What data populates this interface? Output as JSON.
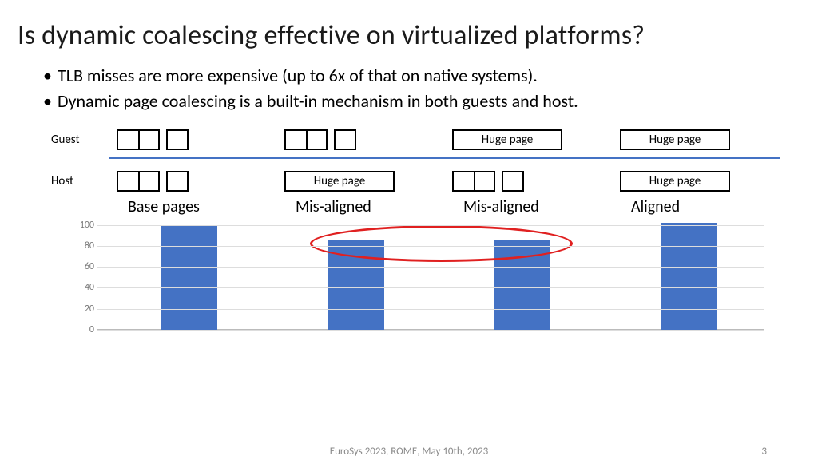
{
  "title": "Is dynamic coalescing effective on virtualized platforms?",
  "bullets": [
    "TLB misses are more expensive (up to 6x of that on native systems).",
    "Dynamic page coalescing is a built-in mechanism in both guests and host."
  ],
  "row_labels": {
    "guest": "Guest",
    "host": "Host"
  },
  "hugepage_label": "Huge page",
  "categories": [
    "Base pages",
    "Mis-aligned",
    "Mis-aligned",
    "Aligned"
  ],
  "chart_data": {
    "type": "bar",
    "categories": [
      "Base pages",
      "Mis-aligned",
      "Mis-aligned",
      "Aligned"
    ],
    "values": [
      100,
      86,
      86,
      102
    ],
    "ylim": [
      0,
      104
    ],
    "yticks": [
      0,
      20,
      40,
      60,
      80,
      100
    ],
    "title": "",
    "xlabel": "",
    "ylabel": ""
  },
  "footer": {
    "venue": "EuroSys 2023, ROME, May 10th, 2023",
    "page": "3"
  }
}
